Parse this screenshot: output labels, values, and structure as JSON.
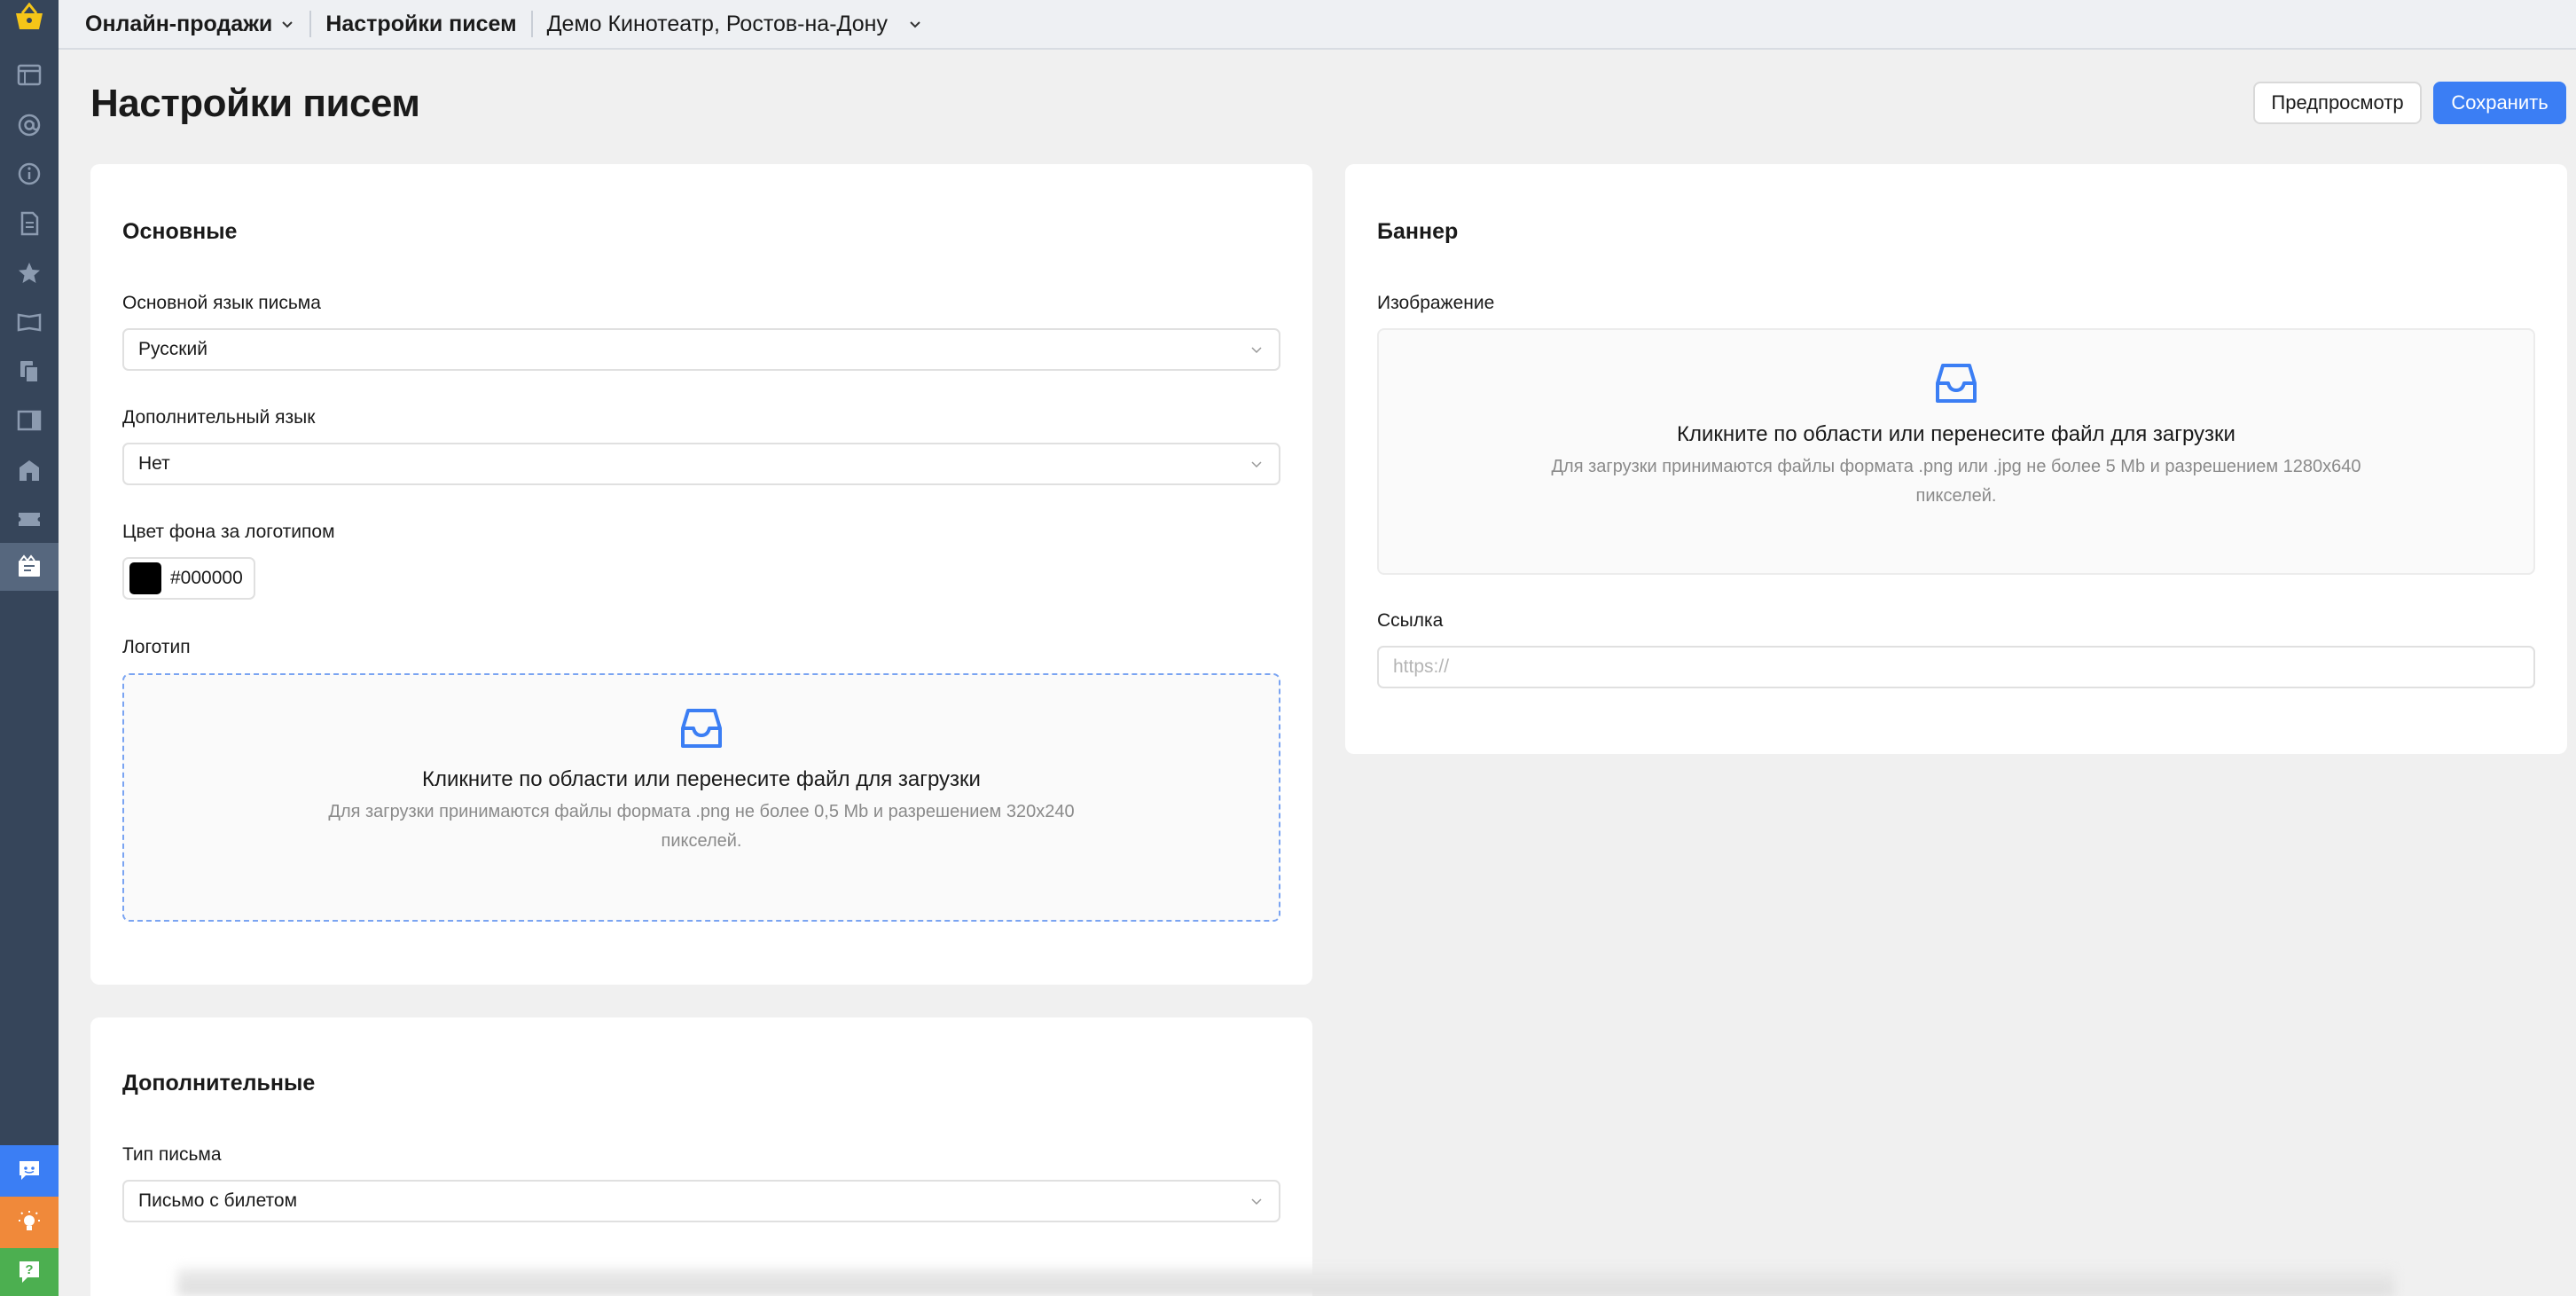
{
  "topbar": {
    "section": "Онлайн-продажи",
    "page": "Настройки писем",
    "venue": "Демо Кинотеатр, Ростов-на-Дону"
  },
  "header": {
    "title": "Настройки писем",
    "preview_label": "Предпросмотр",
    "save_label": "Сохранить"
  },
  "main_card": {
    "title": "Основные",
    "primary_language_label": "Основной язык письма",
    "primary_language_value": "Русский",
    "secondary_language_label": "Дополнительный язык",
    "secondary_language_value": "Нет",
    "bg_color_label": "Цвет фона за логотипом",
    "bg_color_value": "#000000",
    "logo_label": "Логотип",
    "logo_upload_title": "Кликните по области или перенесите файл для загрузки",
    "logo_upload_hint": "Для загрузки принимаются файлы формата .png не более 0,5 Mb и разрешением 320x240 пикселей."
  },
  "banner_card": {
    "title": "Баннер",
    "image_label": "Изображение",
    "image_upload_title": "Кликните по области или перенесите файл для загрузки",
    "image_upload_hint": "Для загрузки принимаются файлы формата .png или .jpg не более 5 Mb и разрешением 1280x640 пикселей.",
    "link_label": "Ссылка",
    "link_placeholder": "https://"
  },
  "extra_card": {
    "title": "Дополнительные",
    "mail_type_label": "Тип письма",
    "mail_type_value": "Письмо с билетом"
  },
  "colors": {
    "sidebar": "#36455a",
    "accent": "#3b7ef4",
    "chat": "#3b7ef4",
    "idea": "#f0893a",
    "help": "#4caf50",
    "logo": "#f5c518"
  },
  "sidebar_icons": [
    "basket-logo-icon",
    "calendar-icon",
    "at-icon",
    "info-icon",
    "document-icon",
    "star-icon",
    "map-icon",
    "copy-icon",
    "panel-icon",
    "building-icon",
    "ticket-icon",
    "email-settings-icon",
    "chat-icon",
    "lightbulb-icon",
    "help-icon"
  ]
}
